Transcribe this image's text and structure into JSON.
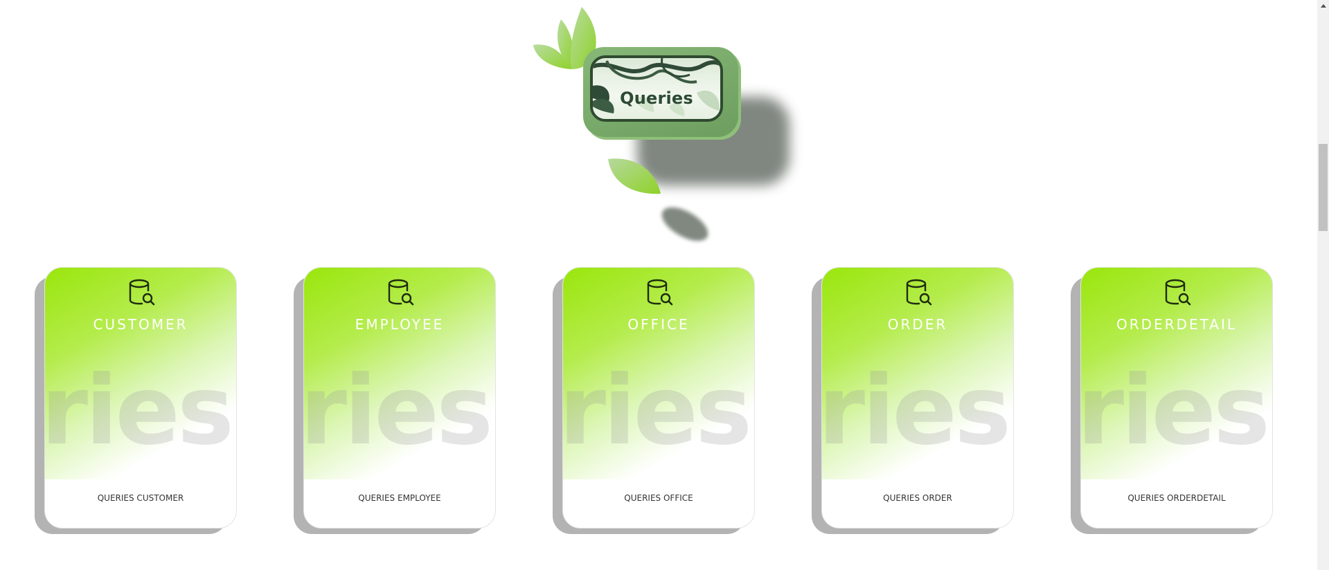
{
  "hero": {
    "title": "Queries"
  },
  "cards": [
    {
      "title": "CUSTOMER",
      "caption": "QUERIES CUSTOMER",
      "watermark": "ries",
      "icon": "database-search-icon"
    },
    {
      "title": "EMPLOYEE",
      "caption": "QUERIES EMPLOYEE",
      "watermark": "ries",
      "icon": "database-search-icon"
    },
    {
      "title": "OFFICE",
      "caption": "QUERIES OFFICE",
      "watermark": "ries",
      "icon": "database-search-icon"
    },
    {
      "title": "ORDER",
      "caption": "QUERIES ORDER",
      "watermark": "ries",
      "icon": "database-search-icon"
    },
    {
      "title": "ORDERDETAIL",
      "caption": "QUERIES ORDERDETAIL",
      "watermark": "ries",
      "icon": "database-search-icon"
    }
  ],
  "colors": {
    "accent": "#9ae60c",
    "badge_green": "#7aab6b",
    "card_shadow": "#b3b3b3"
  }
}
